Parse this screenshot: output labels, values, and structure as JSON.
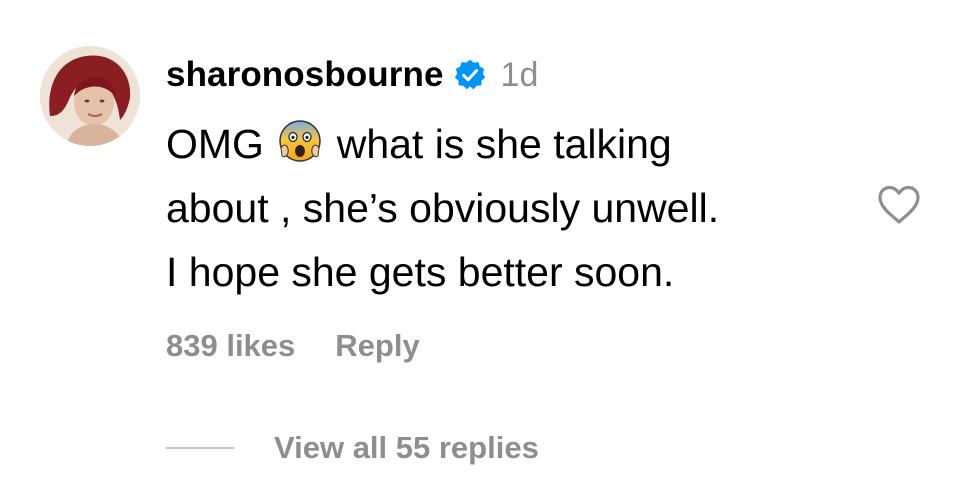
{
  "comment": {
    "username": "sharonosbourne",
    "timestamp": "1d",
    "text_before_emoji": "OMG ",
    "text_after_emoji": " what is she talking\nabout , she’s obviously unwell.\nI hope she gets better soon.",
    "emoji_icon": "screaming-face-emoji",
    "verified_icon": "verified-badge-icon",
    "like_icon": "heart-outline-icon",
    "avatar_icon": "profile-avatar"
  },
  "actions": {
    "likes": "839 likes",
    "reply": "Reply"
  },
  "replies": {
    "view_all": "View all 55 replies"
  },
  "colors": {
    "verified": "#0095f6",
    "muted": "#8e8e8e",
    "divider": "#c7c7c7"
  }
}
